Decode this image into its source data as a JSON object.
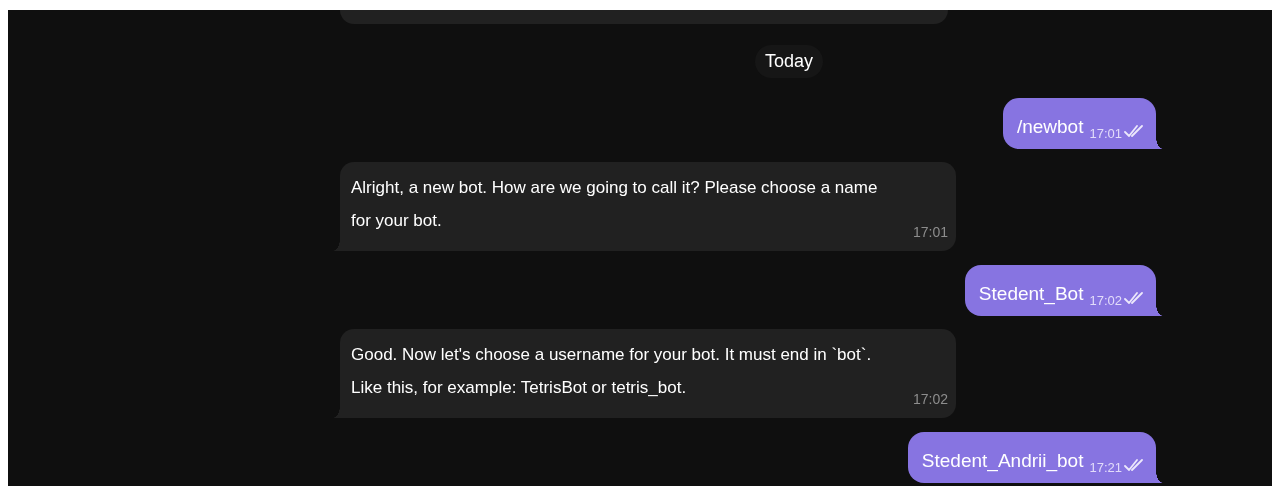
{
  "date_divider": "Today",
  "messages": [
    {
      "kind": "outgoing",
      "text": "/newbot",
      "time": "17:01",
      "read": true
    },
    {
      "kind": "incoming",
      "text": "Alright, a new bot. How are we going to call it? Please choose a name for your bot.",
      "time": "17:01"
    },
    {
      "kind": "outgoing",
      "text": "Stedent_Bot",
      "time": "17:02",
      "read": true
    },
    {
      "kind": "incoming",
      "text": "Good. Now let's choose a username for your bot. It must end in `bot`. Like this, for example: TetrisBot or tetris_bot.",
      "time": "17:02"
    },
    {
      "kind": "outgoing",
      "text": "Stedent_Andrii_bot",
      "time": "17:21",
      "read": true
    }
  ]
}
